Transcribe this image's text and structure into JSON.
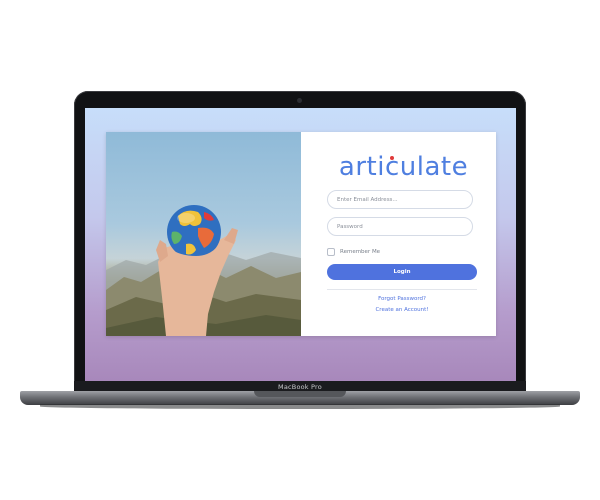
{
  "device": {
    "model_label": "MacBook Pro"
  },
  "login": {
    "logo_text": "articulate",
    "email_placeholder": "Enter Email Address...",
    "password_placeholder": "Password",
    "remember_label": "Remember Me",
    "login_button": "Login",
    "forgot_password_link": "Forgot Password?",
    "create_account_link": "Create an Account!"
  },
  "colors": {
    "accent": "#4f72de",
    "logo": "#4f7fe0",
    "logo_dot": "#e03a3a"
  },
  "icons": {
    "photo": "hand-holding-globe-image"
  }
}
